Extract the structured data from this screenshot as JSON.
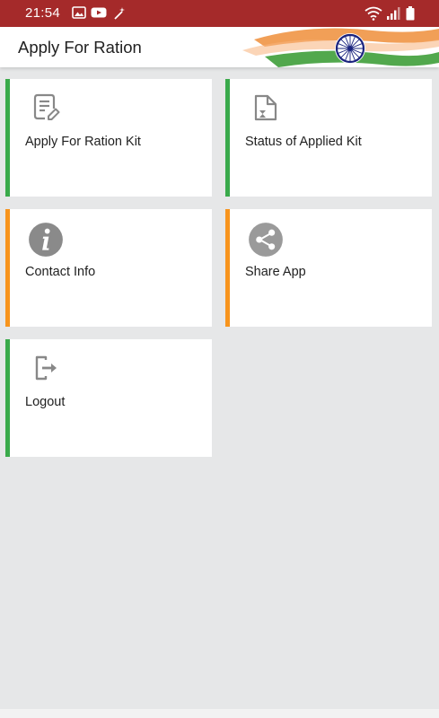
{
  "status_bar": {
    "time": "21:54",
    "left_icons": [
      "image-icon",
      "youtube-icon",
      "magic-wand-icon"
    ],
    "right_icons": [
      "wifi-icon",
      "signal-icon",
      "battery-icon"
    ]
  },
  "app_bar": {
    "title": "Apply For Ration",
    "banner": "indian-flag-banner"
  },
  "colors": {
    "status_bar": "#a52a2a",
    "green_accent": "#3aaa4b",
    "orange_accent": "#f7941d",
    "background": "#e6e7e8",
    "icon_gray": "#8a8a8a"
  },
  "menu": {
    "items": [
      {
        "label": "Apply For Ration Kit",
        "icon": "edit-document-icon",
        "accent": "green"
      },
      {
        "label": "Status of Applied Kit",
        "icon": "document-hourglass-icon",
        "accent": "green"
      },
      {
        "label": "Contact Info",
        "icon": "info-icon",
        "accent": "orange"
      },
      {
        "label": "Share App",
        "icon": "share-icon",
        "accent": "orange"
      },
      {
        "label": "Logout",
        "icon": "logout-icon",
        "accent": "green"
      }
    ]
  }
}
